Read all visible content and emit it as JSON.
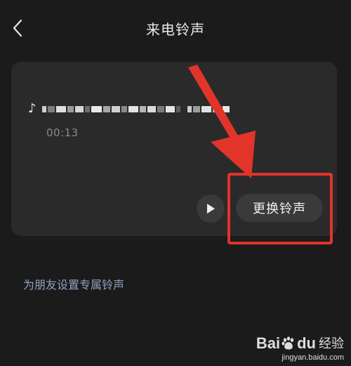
{
  "header": {
    "title": "来电铃声",
    "back_icon": "chevron-left-icon"
  },
  "ringtone": {
    "note_glyph": "♪",
    "duration": "00:13",
    "change_label": "更换铃声",
    "play_icon": "play-icon"
  },
  "friend_link": "为朋友设置专属铃声",
  "watermark": {
    "brand_left": "Bai",
    "brand_right": "du",
    "jingyan": "经验",
    "url": "jingyan.baidu.com"
  },
  "colors": {
    "background": "#1b1b1c",
    "card": "#2a2a2b",
    "button": "#3a3a3c",
    "link": "#8fa3c0",
    "annotation": "#e2342a"
  }
}
